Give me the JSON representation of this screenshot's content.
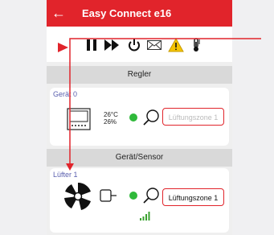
{
  "app": {
    "title": "Easy Connect e16",
    "back_icon": "arrow-left-icon"
  },
  "toolbar": {
    "icons": [
      "play-icon",
      "pause-icon",
      "fast-forward-icon",
      "power-icon",
      "mail-icon",
      "warning-icon",
      "thermometer-icon"
    ]
  },
  "sections": {
    "regler": {
      "header": "Regler"
    },
    "sensor": {
      "header": "Gerät/Sensor"
    }
  },
  "devices": {
    "geraet0": {
      "label": "Gerät 0",
      "temperature": "26°C",
      "humidity": "26%",
      "zone": "Lüftungszone 1",
      "zone_active": false
    },
    "luefter1": {
      "label": "Lüfter 1",
      "zone": "Lüftungszone 1",
      "zone_active": true
    }
  },
  "colors": {
    "brand_red": "#e1242b",
    "status_green": "#2fb93a",
    "warning_yellow": "#f5c400",
    "label_purple": "#5a5fae"
  }
}
